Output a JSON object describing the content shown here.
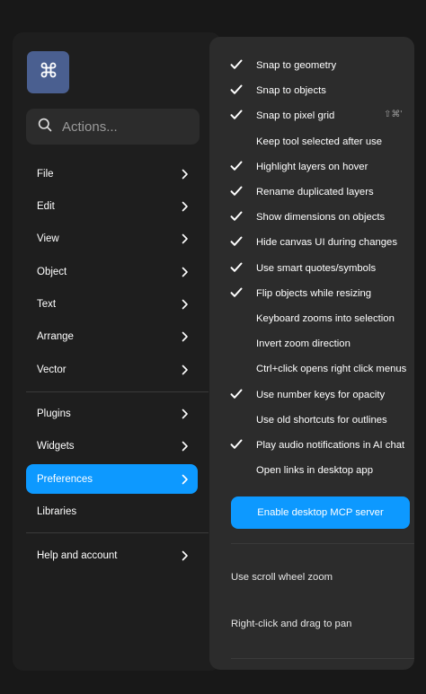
{
  "logo": {
    "icon": "command-icon"
  },
  "search": {
    "placeholder": "Actions..."
  },
  "menu": {
    "items": [
      {
        "label": "File",
        "has_submenu": true
      },
      {
        "label": "Edit",
        "has_submenu": true
      },
      {
        "label": "View",
        "has_submenu": true
      },
      {
        "label": "Object",
        "has_submenu": true
      },
      {
        "label": "Text",
        "has_submenu": true
      },
      {
        "label": "Arrange",
        "has_submenu": true
      },
      {
        "label": "Vector",
        "has_submenu": true
      },
      {
        "label": "Plugins",
        "has_submenu": true
      },
      {
        "label": "Widgets",
        "has_submenu": true
      },
      {
        "label": "Preferences",
        "has_submenu": true,
        "active": true
      },
      {
        "label": "Libraries",
        "has_submenu": false
      },
      {
        "label": "Help and account",
        "has_submenu": true
      }
    ]
  },
  "preferences": {
    "items": [
      {
        "label": "Snap to geometry",
        "checked": true
      },
      {
        "label": "Snap to objects",
        "checked": true
      },
      {
        "label": "Snap to pixel grid",
        "checked": true,
        "shortcut": "⇧⌘'"
      },
      {
        "label": "Keep tool selected after use",
        "checked": false
      },
      {
        "label": "Highlight layers on hover",
        "checked": true
      },
      {
        "label": "Rename duplicated layers",
        "checked": true
      },
      {
        "label": "Show dimensions on objects",
        "checked": true
      },
      {
        "label": "Hide canvas UI during changes",
        "checked": true
      },
      {
        "label": "Use smart quotes/symbols",
        "checked": true
      },
      {
        "label": "Flip objects while resizing",
        "checked": true
      },
      {
        "label": "Keyboard zooms into selection",
        "checked": false
      },
      {
        "label": "Invert zoom direction",
        "checked": false
      },
      {
        "label": "Ctrl+click opens right click menus",
        "checked": false
      },
      {
        "label": "Use number keys for opacity",
        "checked": true
      },
      {
        "label": "Use old shortcuts for outlines",
        "checked": false
      },
      {
        "label": "Play audio notifications in AI chat",
        "checked": true
      },
      {
        "label": "Open links in desktop app",
        "checked": false
      }
    ],
    "mcp_button": "Enable desktop MCP server",
    "scroll_wheel_zoom": "Use scroll wheel zoom",
    "right_click_pan": "Right-click and drag to pan"
  },
  "colors": {
    "accent": "#0d99ff",
    "logo_bg": "#4a5f90",
    "panel_left": "#1e1e1e",
    "panel_right": "#2c2c2c"
  }
}
